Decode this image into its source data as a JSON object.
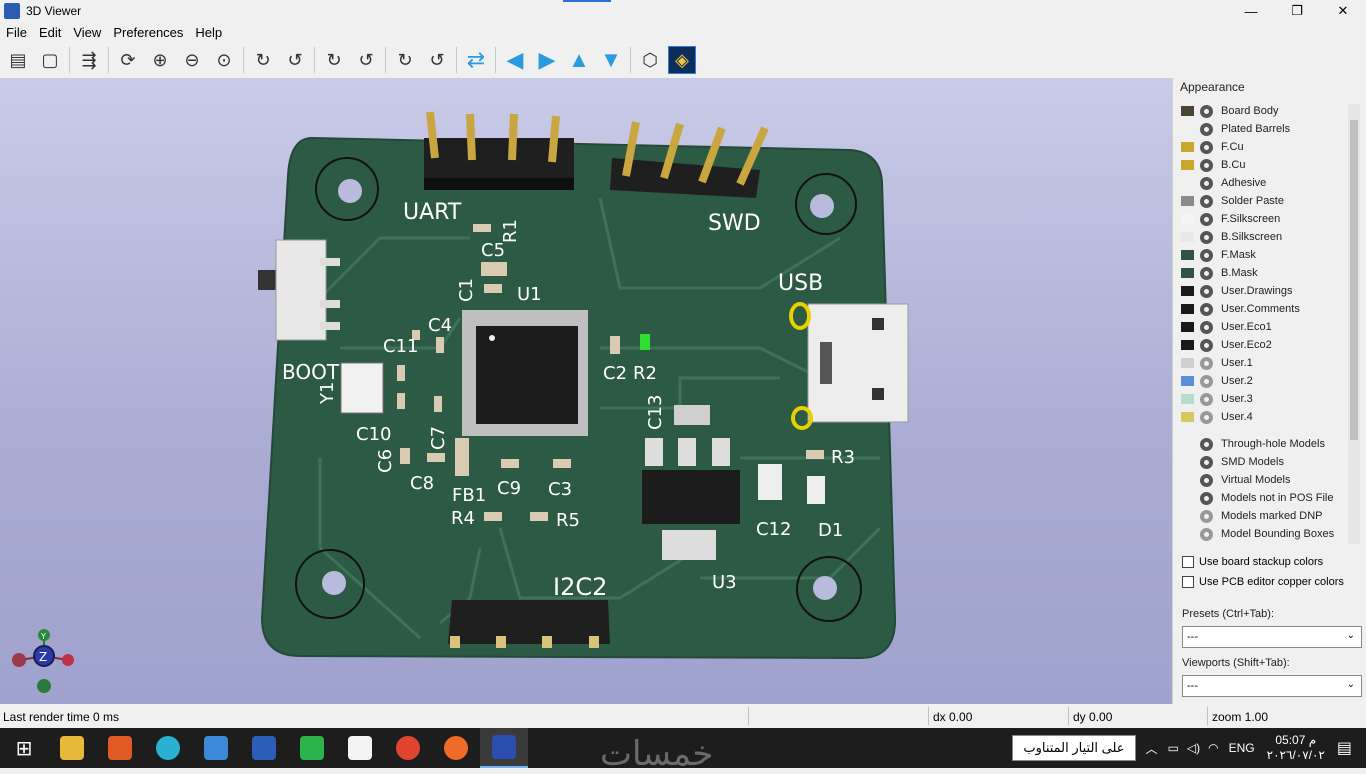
{
  "window": {
    "title": "3D Viewer",
    "minimize": "—",
    "maximize": "❐",
    "close": "✕"
  },
  "menu": [
    "File",
    "Edit",
    "View",
    "Preferences",
    "Help"
  ],
  "toolbar": [
    {
      "name": "export-image-icon",
      "glyph": "▤",
      "style": ""
    },
    {
      "name": "copy-clipboard-icon",
      "glyph": "▢",
      "style": ""
    },
    {
      "sep": true
    },
    {
      "name": "raytrace-icon",
      "glyph": "⇶",
      "style": ""
    },
    {
      "sep": true
    },
    {
      "name": "reload-icon",
      "glyph": "⟳",
      "style": ""
    },
    {
      "name": "zoom-in-icon",
      "glyph": "⊕",
      "style": ""
    },
    {
      "name": "zoom-out-icon",
      "glyph": "⊖",
      "style": ""
    },
    {
      "name": "zoom-fit-icon",
      "glyph": "⊙",
      "style": ""
    },
    {
      "sep": true
    },
    {
      "name": "rotate-x-cw-icon",
      "glyph": "↻",
      "style": ""
    },
    {
      "name": "rotate-x-ccw-icon",
      "glyph": "↺",
      "style": ""
    },
    {
      "sep": true
    },
    {
      "name": "rotate-y-cw-icon",
      "glyph": "↻",
      "style": ""
    },
    {
      "name": "rotate-y-ccw-icon",
      "glyph": "↺",
      "style": ""
    },
    {
      "sep": true
    },
    {
      "name": "rotate-z-cw-icon",
      "glyph": "↻",
      "style": ""
    },
    {
      "name": "rotate-z-ccw-icon",
      "glyph": "↺",
      "style": ""
    },
    {
      "sep": true
    },
    {
      "name": "flip-board-icon",
      "glyph": "⇄",
      "style": "blue"
    },
    {
      "sep": true
    },
    {
      "name": "pan-left-icon",
      "glyph": "◀",
      "style": "blue"
    },
    {
      "name": "pan-right-icon",
      "glyph": "▶",
      "style": "blue"
    },
    {
      "name": "pan-up-icon",
      "glyph": "▲",
      "style": "blue"
    },
    {
      "name": "pan-down-icon",
      "glyph": "▼",
      "style": "blue"
    },
    {
      "sep": true
    },
    {
      "name": "ortho-view-icon",
      "glyph": "⬡",
      "style": ""
    },
    {
      "name": "layers-manager-icon",
      "glyph": "◈",
      "style": "active"
    }
  ],
  "appearance": {
    "title": "Appearance",
    "layers": [
      {
        "name": "Board Body",
        "color": "#4a4535",
        "hidden": false
      },
      {
        "name": "Plated Barrels",
        "color": "",
        "hidden": false
      },
      {
        "name": "F.Cu",
        "color": "#c8a82a",
        "hidden": false
      },
      {
        "name": "B.Cu",
        "color": "#c8a82a",
        "hidden": false
      },
      {
        "name": "Adhesive",
        "color": "",
        "hidden": false
      },
      {
        "name": "Solder Paste",
        "color": "#8a8a8a",
        "hidden": false
      },
      {
        "name": "F.Silkscreen",
        "color": "#f4f4f4",
        "hidden": false
      },
      {
        "name": "B.Silkscreen",
        "color": "#e8e8e8",
        "hidden": false
      },
      {
        "name": "F.Mask",
        "color": "#2f5446",
        "hidden": false
      },
      {
        "name": "B.Mask",
        "color": "#2f5446",
        "hidden": false
      },
      {
        "name": "User.Drawings",
        "color": "#1a1a1a",
        "hidden": false
      },
      {
        "name": "User.Comments",
        "color": "#1a1a1a",
        "hidden": false
      },
      {
        "name": "User.Eco1",
        "color": "#1a1a1a",
        "hidden": false
      },
      {
        "name": "User.Eco2",
        "color": "#1a1a1a",
        "hidden": false
      },
      {
        "name": "User.1",
        "color": "#cfcfcf",
        "hidden": true
      },
      {
        "name": "User.2",
        "color": "#5a8ed8",
        "hidden": true
      },
      {
        "name": "User.3",
        "color": "#b8dcd0",
        "hidden": true
      },
      {
        "name": "User.4",
        "color": "#d8c860",
        "hidden": true
      }
    ],
    "models": [
      {
        "name": "Through-hole Models",
        "hidden": false
      },
      {
        "name": "SMD Models",
        "hidden": false
      },
      {
        "name": "Virtual Models",
        "hidden": false
      },
      {
        "name": "Models not in POS File",
        "hidden": false
      },
      {
        "name": "Models marked DNP",
        "hidden": true
      },
      {
        "name": "Model Bounding Boxes",
        "hidden": true
      }
    ],
    "use_stackup_colors": "Use board stackup colors",
    "use_pcb_colors": "Use PCB editor copper colors",
    "presets_label": "Presets (Ctrl+Tab):",
    "presets_value": "---",
    "viewports_label": "Viewports (Shift+Tab):",
    "viewports_value": "---"
  },
  "board_labels": {
    "uart": "UART",
    "swd": "SWD",
    "usb": "USB",
    "boot": "BOOT",
    "i2c2": "I2C2",
    "u1": "U1",
    "u3": "U3",
    "r1": "R1",
    "r2": "R2",
    "r3": "R3",
    "r4": "R4",
    "r5": "R5",
    "c1": "C1",
    "c2": "C2",
    "c3": "C3",
    "c4": "C4",
    "c5": "C5",
    "c6": "C6",
    "c7": "C7",
    "c8": "C8",
    "c9": "C9",
    "c10": "C10",
    "c11": "C11",
    "c12": "C12",
    "c13": "C13",
    "y1": "Y1",
    "fb1": "FB1",
    "d1": "D1"
  },
  "axes": {
    "y": "Y",
    "z": "Z"
  },
  "status": {
    "render": "Last render time 0 ms",
    "dx": "dx 0.00",
    "dy": "dy 0.00",
    "zoom": "zoom 1.00"
  },
  "taskbar": {
    "watermark": "خمسات",
    "notification": "على التيار المتناوب",
    "lang": "ENG",
    "time": "05:07 م",
    "date": "٢٠٢٦/٠٧/٠٢"
  }
}
